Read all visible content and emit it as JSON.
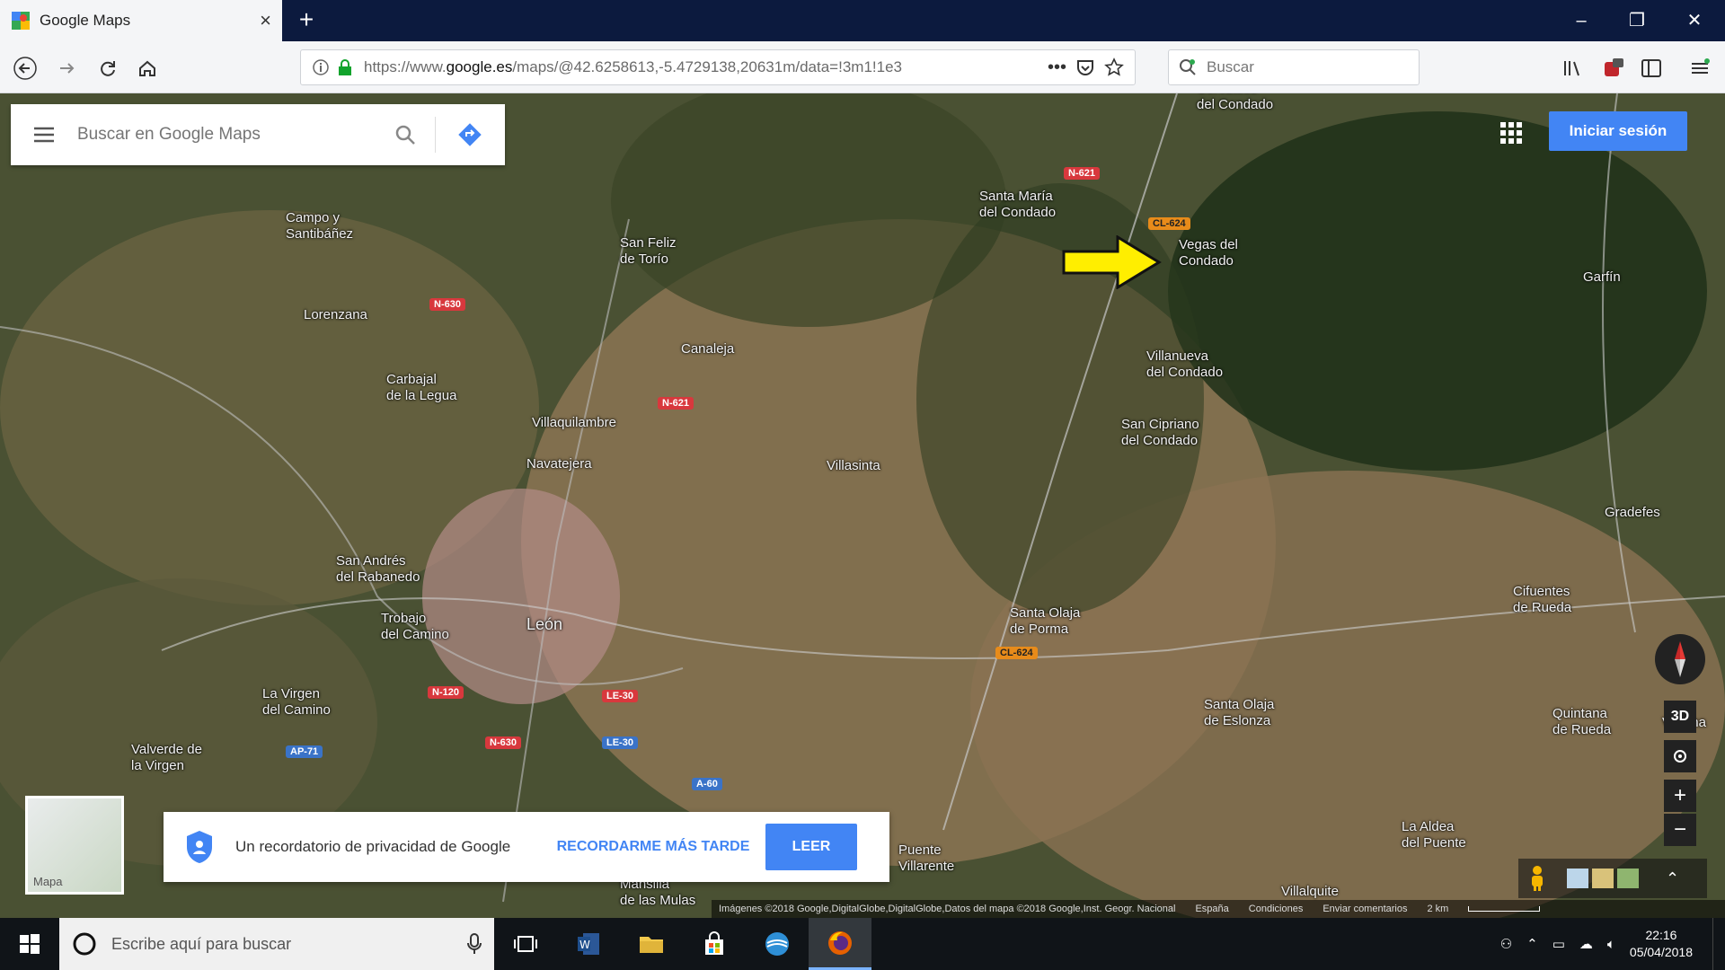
{
  "browser": {
    "tab_title": "Google Maps",
    "url_domain": "google.es",
    "url_prefix": "https://www.",
    "url_rest": "/maps/@42.6258613,-5.4729138,20631m/data=!3m1!1e3",
    "search_placeholder": "Buscar"
  },
  "maps": {
    "search_placeholder": "Buscar en Google Maps",
    "signin_label": "Iniciar sesión",
    "ctl_3d": "3D",
    "minimap_label": "Mapa",
    "places": [
      "Cerezales\ndel Condado",
      "Santa María\ndel Condado",
      "Vegas del\nCondado",
      "Campo y\nSantibáñez",
      "San Feliz\nde Torío",
      "Lorenzana",
      "Canaleja",
      "Carbajal\nde la Legua",
      "Villaquilambre",
      "Villanueva\ndel Condado",
      "San Cipriano\ndel Condado",
      "Navatejera",
      "San Andrés\ndel Rabanedo",
      "Trobajo\ndel Camino",
      "León",
      "Villasinta",
      "Santa Olaja\nde Porma",
      "Gradefes",
      "Cifuentes\nde Rueda",
      "Quintana\nde Rueda",
      "La Virgen\ndel Camino",
      "Valverde de\nla Virgen",
      "Puente\nVillarente",
      "Mansilla\nde las Mulas",
      "Santa Olaja\nde Eslonza",
      "La Aldea\ndel Puente",
      "Villalquite",
      "Garfín",
      "Vilecha"
    ],
    "roads": [
      "N-621",
      "CL-624",
      "N-630",
      "N-621",
      "LE-30",
      "LE-30",
      "N-120",
      "N-630",
      "AP-71",
      "A-60",
      "CL-624"
    ]
  },
  "privacy": {
    "message": "Un recordatorio de privacidad de Google",
    "later_label": "RECORDARME MÁS TARDE",
    "read_label": "LEER"
  },
  "footer": {
    "imagery": "Imágenes ©2018 Google,DigitalGlobe,DigitalGlobe,Datos del mapa ©2018 Google,Inst. Geogr. Nacional",
    "country": "España",
    "terms": "Condiciones",
    "feedback": "Enviar comentarios",
    "scale": "2 km"
  },
  "taskbar": {
    "search_placeholder": "Escribe aquí para buscar",
    "time": "22:16",
    "date": "05/04/2018"
  }
}
